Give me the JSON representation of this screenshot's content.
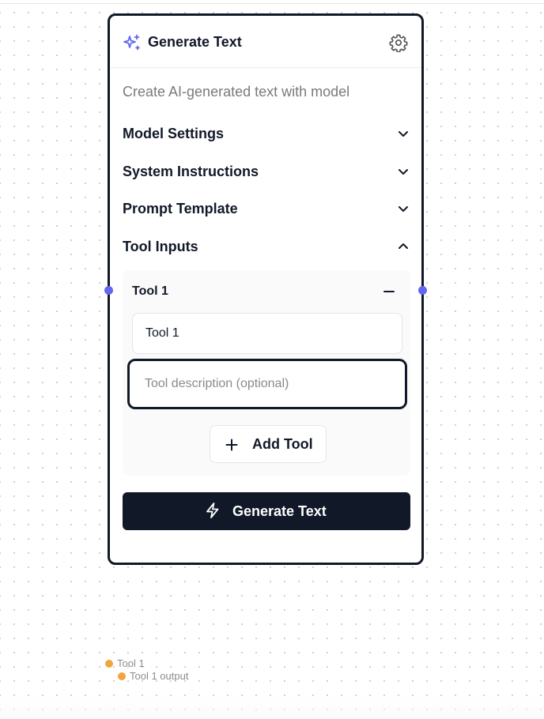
{
  "node": {
    "title": "Generate Text",
    "subtitle": "Create AI-generated text with model",
    "header_icon": "sparkles-icon",
    "settings_icon": "gear-icon",
    "accent_color": "#6366f1",
    "border_color": "#111827"
  },
  "sections": [
    {
      "label": "Model Settings",
      "state": "collapsed",
      "icon": "chevron-down-icon"
    },
    {
      "label": "System Instructions",
      "state": "collapsed",
      "icon": "chevron-down-icon"
    },
    {
      "label": "Prompt Template",
      "state": "collapsed",
      "icon": "chevron-down-icon"
    },
    {
      "label": "Tool Inputs",
      "state": "expanded",
      "icon": "chevron-up-icon"
    }
  ],
  "tool": {
    "heading": "Tool 1",
    "name_value": "Tool 1",
    "description_placeholder": "Tool description (optional)",
    "remove_icon": "minus-icon"
  },
  "add_tool": {
    "label": "Add Tool",
    "icon": "plus-icon"
  },
  "generate_button": {
    "label": "Generate Text",
    "icon": "lightning-icon",
    "background": "#111827"
  },
  "canvas_nodes": [
    {
      "label": "Tool 1",
      "color": "#f0a63a"
    },
    {
      "label": "Tool 1 output",
      "color": "#f0a63a"
    }
  ]
}
